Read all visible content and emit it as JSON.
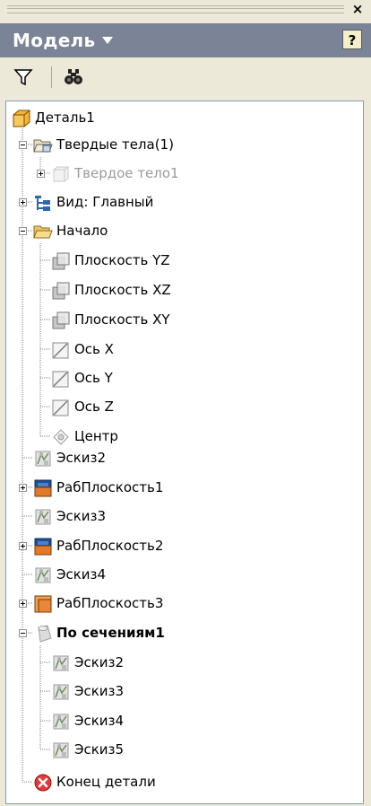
{
  "panel": {
    "title": "Модель",
    "help_label": "?",
    "close_label": "×"
  },
  "toolbar": {
    "filter_icon": "filter-icon",
    "find_icon": "binoculars-icon"
  },
  "tree": {
    "items": [
      {
        "label": "Деталь1",
        "icon": "part-icon"
      },
      {
        "label": "Твердые тела(1)",
        "icon": "solid-bodies-folder-icon"
      },
      {
        "label": "Твердое тело1",
        "icon": "solid-body-icon"
      },
      {
        "label": "Вид: Главный",
        "icon": "view-rep-icon"
      },
      {
        "label": "Начало",
        "icon": "origin-folder-icon"
      },
      {
        "label": "Плоскость YZ",
        "icon": "plane-icon"
      },
      {
        "label": "Плоскость XZ",
        "icon": "plane-icon"
      },
      {
        "label": "Плоскость XY",
        "icon": "plane-icon"
      },
      {
        "label": "Ось X",
        "icon": "axis-icon"
      },
      {
        "label": "Ось Y",
        "icon": "axis-icon"
      },
      {
        "label": "Ось Z",
        "icon": "axis-icon"
      },
      {
        "label": "Центр",
        "icon": "center-point-icon"
      },
      {
        "label": "Эскиз2",
        "icon": "sketch-icon"
      },
      {
        "label": "РабПлоскость1",
        "icon": "work-plane-icon"
      },
      {
        "label": "Эскиз3",
        "icon": "sketch-icon"
      },
      {
        "label": "РабПлоскость2",
        "icon": "work-plane-icon"
      },
      {
        "label": "Эскиз4",
        "icon": "sketch-icon"
      },
      {
        "label": "РабПлоскость3",
        "icon": "work-plane-icon"
      },
      {
        "label": "По сечениям1",
        "icon": "loft-icon"
      },
      {
        "label": "Эскиз2",
        "icon": "sketch-icon"
      },
      {
        "label": "Эскиз3",
        "icon": "sketch-icon"
      },
      {
        "label": "Эскиз4",
        "icon": "sketch-icon"
      },
      {
        "label": "Эскиз5",
        "icon": "sketch-icon"
      },
      {
        "label": "Конец детали",
        "icon": "end-of-part-icon"
      }
    ]
  },
  "colors": {
    "header_bg": "#7a8496",
    "chrome_bg": "#ece9d8",
    "tree_border": "#7f9db9",
    "disabled_text": "#9a9a9a"
  }
}
